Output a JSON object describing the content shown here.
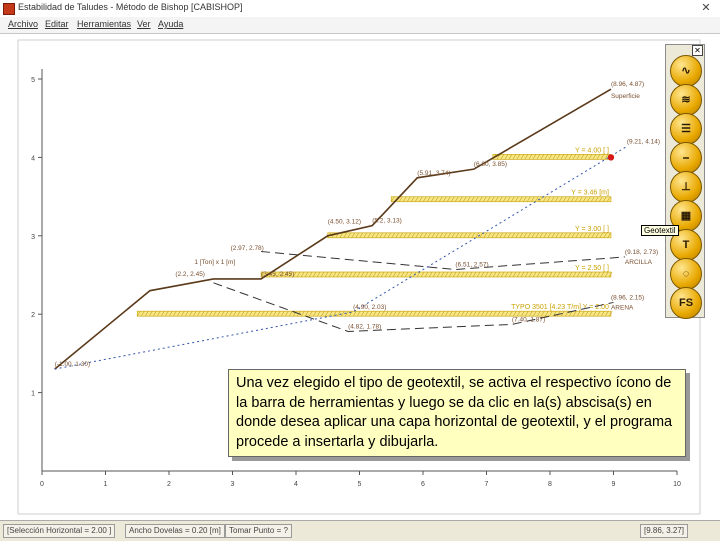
{
  "window": {
    "title": "Estabilidad de Taludes - Método de Bishop [CABISHOP]",
    "close_glyph": "✕"
  },
  "menu": [
    "Archivo",
    "Editar",
    "Herramientas",
    "Ver",
    "Ayuda"
  ],
  "chart_data": {
    "type": "line",
    "x_ticks": [
      "0",
      "1",
      "2",
      "3",
      "4",
      "5",
      "6",
      "7",
      "8",
      "9",
      "10"
    ],
    "y_ticks": [
      "1",
      "2",
      "3",
      "4",
      "5"
    ],
    "xlim": [
      0,
      10
    ],
    "ylim": [
      0,
      5
    ],
    "series": [
      {
        "role": "surface",
        "color": "#5a3a1a",
        "points": [
          [
            0.2,
            1.3
          ],
          [
            1.7,
            2.3
          ],
          [
            2.7,
            2.45
          ],
          [
            3.45,
            2.45
          ],
          [
            4.5,
            3.0
          ],
          [
            5.2,
            3.13
          ],
          [
            5.91,
            3.74
          ],
          [
            6.8,
            3.85
          ],
          [
            8.96,
            4.87
          ]
        ]
      },
      {
        "role": "dashed-curve",
        "color": "#333333",
        "points": [
          [
            3.45,
            2.8
          ],
          [
            6.51,
            2.57
          ],
          [
            9.18,
            2.73
          ]
        ]
      },
      {
        "role": "dashed-curve",
        "color": "#333333",
        "points": [
          [
            2.7,
            2.4
          ],
          [
            4.82,
            1.78
          ],
          [
            7.4,
            1.87
          ],
          [
            9.0,
            2.15
          ]
        ]
      },
      {
        "role": "phreatic",
        "color": "#3355aa",
        "points": [
          [
            0.2,
            1.3
          ],
          [
            4.9,
            2.03
          ],
          [
            9.21,
            4.14
          ]
        ]
      }
    ],
    "reinforcement_layers": [
      {
        "label": "Y = 4.00 [ ]",
        "y": 4.0,
        "x1": 7.1,
        "x2": 8.96
      },
      {
        "label": "Y = 3.46 [m]",
        "y": 3.46,
        "x1": 5.5,
        "x2": 8.96
      },
      {
        "label": "Y = 3.00 [ ]",
        "y": 3.0,
        "x1": 4.5,
        "x2": 8.96
      },
      {
        "label": "Y = 2.50 [ ]",
        "y": 2.5,
        "x1": 3.45,
        "x2": 8.96
      },
      {
        "label": "TYPO 3501 [4.23 T/m] Y = 2.00",
        "y": 2.0,
        "x1": 1.5,
        "x2": 8.96
      }
    ],
    "annotations": [
      {
        "text": "(8.96, 4.87)",
        "x": 8.96,
        "y": 4.87
      },
      {
        "text": "Superficie",
        "x": 8.96,
        "y": 4.72
      },
      {
        "text": "(9.21, 4.14)",
        "x": 9.21,
        "y": 4.14
      },
      {
        "text": "(6.80, 3.85)",
        "x": 6.8,
        "y": 3.85
      },
      {
        "text": "(5.91, 3.74)",
        "x": 5.91,
        "y": 3.74
      },
      {
        "text": "(5.2, 3.13)",
        "x": 5.2,
        "y": 3.13
      },
      {
        "text": "(4.50, 3.12)",
        "x": 4.5,
        "y": 3.12
      },
      {
        "text": "(2.97, 2.78)",
        "x": 2.97,
        "y": 2.78
      },
      {
        "text": "(9.18, 2.73)",
        "x": 9.18,
        "y": 2.73
      },
      {
        "text": "ARCILLA",
        "x": 9.18,
        "y": 2.6
      },
      {
        "text": "(6.51, 2.57)",
        "x": 6.51,
        "y": 2.57
      },
      {
        "text": "1 [Ton] x 1 [m]",
        "x": 2.4,
        "y": 2.6
      },
      {
        "text": "(2.2, 2.45)",
        "x": 2.1,
        "y": 2.45
      },
      {
        "text": "(3.45, 2.45)",
        "x": 3.45,
        "y": 2.45
      },
      {
        "text": "(4.90, 2.03)",
        "x": 4.9,
        "y": 2.03
      },
      {
        "text": "(8.96, 2.15)",
        "x": 8.96,
        "y": 2.15
      },
      {
        "text": "ARENA",
        "x": 8.96,
        "y": 2.02
      },
      {
        "text": "(4.82, 1.78)",
        "x": 4.82,
        "y": 1.78
      },
      {
        "text": "(7.40, 1.87)",
        "x": 7.4,
        "y": 1.87
      },
      {
        "text": "(-1.00, 1.30)",
        "x": 0.2,
        "y": 1.3
      }
    ]
  },
  "toolpanel": {
    "close_glyph": "✕",
    "tools": [
      {
        "id": "surface",
        "label": "∿"
      },
      {
        "id": "water",
        "label": "≋"
      },
      {
        "id": "layers",
        "label": "☰"
      },
      {
        "id": "line",
        "label": "⎯"
      },
      {
        "id": "anchor",
        "label": "⊥"
      },
      {
        "id": "geotextile",
        "label": "▦"
      },
      {
        "id": "tension",
        "label": "T"
      },
      {
        "id": "circle",
        "label": "◌"
      },
      {
        "id": "fs",
        "label": "FS"
      }
    ],
    "tooltip": "Geotextil"
  },
  "callout": {
    "text": "Una vez elegido el tipo de geotextil, se activa el respectivo ícono de la barra de herramientas y luego se da clic en la(s) abscisa(s) en donde desea aplicar una capa horizontal de geotextil, y el programa procede a insertarla y dibujarla."
  },
  "statusbar": {
    "seg1": "[Selección Horizontal = 2.00 ]",
    "seg2": "Ancho Dovelas = 0.20 [m]",
    "seg3": "Tomar Punto = ?",
    "seg4": "[9.86, 3.27]"
  }
}
